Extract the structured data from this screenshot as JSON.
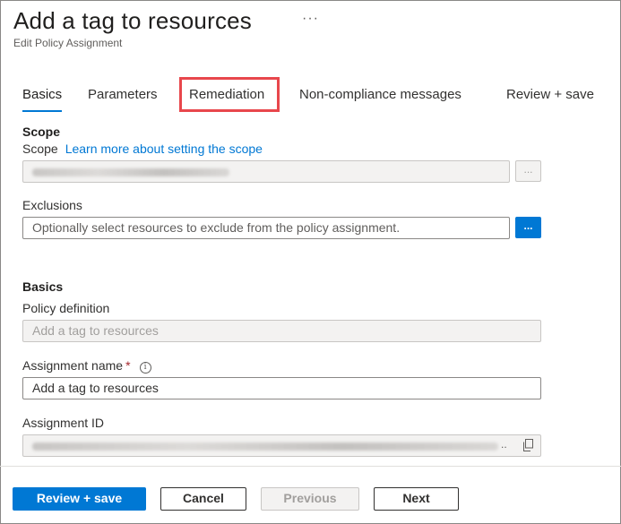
{
  "header": {
    "title": "Add a tag to resources",
    "more_icon": "ellipsis-icon",
    "more_label": "···",
    "subtitle": "Edit Policy Assignment"
  },
  "tabs": [
    {
      "label": "Basics",
      "active": true
    },
    {
      "label": "Parameters",
      "active": false
    },
    {
      "label": "Remediation",
      "active": false,
      "highlighted": true
    },
    {
      "label": "Non-compliance messages",
      "active": false
    },
    {
      "label": "Review + save",
      "active": false
    }
  ],
  "scope": {
    "section_title": "Scope",
    "label": "Scope",
    "link": "Learn more about setting the scope",
    "value_obscured": true,
    "browse_label": "..."
  },
  "exclusions": {
    "label": "Exclusions",
    "placeholder": "Optionally select resources to exclude from the policy assignment.",
    "browse_label": "..."
  },
  "basics": {
    "section_title": "Basics",
    "policy_definition_label": "Policy definition",
    "policy_definition_value": "Add a tag to resources",
    "assignment_name_label": "Assignment name",
    "assignment_name_required": "*",
    "assignment_name_value": "Add a tag to resources",
    "assignment_id_label": "Assignment ID",
    "assignment_id_obscured": true,
    "assignment_id_ellipsis": ".."
  },
  "footer": {
    "review_save": "Review + save",
    "cancel": "Cancel",
    "previous": "Previous",
    "next": "Next"
  },
  "colors": {
    "accent": "#0078d4",
    "highlight": "#e8474c",
    "required": "#a4262c"
  }
}
